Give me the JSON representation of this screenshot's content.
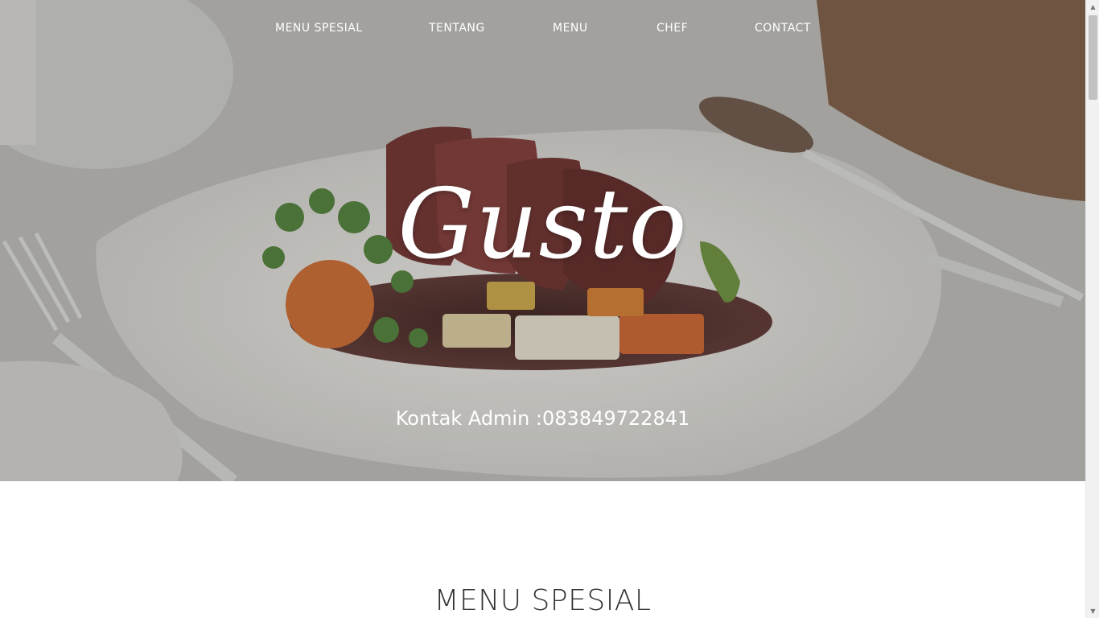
{
  "nav": {
    "items": [
      {
        "label": "MENU SPESIAL"
      },
      {
        "label": "TENTANG"
      },
      {
        "label": "MENU"
      },
      {
        "label": "CHEF"
      },
      {
        "label": "CONTACT"
      }
    ]
  },
  "hero": {
    "brand": "Gusto",
    "contact": "Kontak Admin :083849722841"
  },
  "section": {
    "title": "MENU SPESIAL"
  },
  "colors": {
    "nav_text": "#ffffff",
    "section_title": "#333333"
  },
  "icons": {
    "scroll_up": "triangle-up-icon",
    "scroll_down": "triangle-down-icon"
  }
}
